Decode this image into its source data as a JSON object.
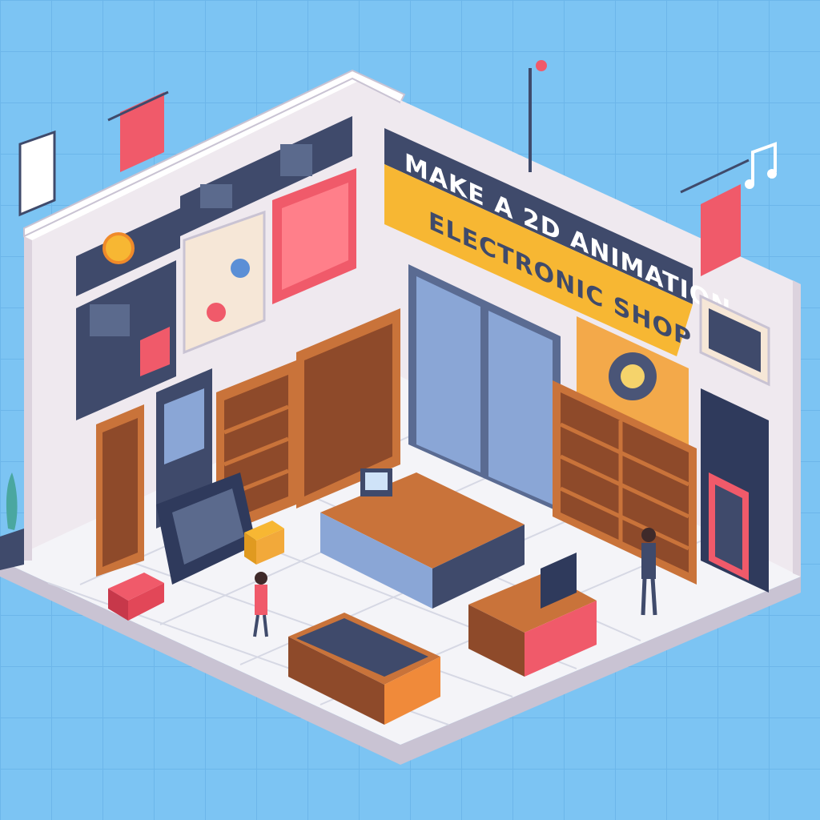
{
  "scene": {
    "description_free": true,
    "colors": {
      "background": "#7cc4f3",
      "grid": "#6cb6ea",
      "wall": "#efe9ef",
      "wall_shade": "#dcd3de",
      "floor": "#f4f4f8",
      "floor_line": "#d6d8e4",
      "sign_dark": "#3f4a6b",
      "sign_yellow": "#f7b733",
      "accent_red": "#f05a6a",
      "wood": "#c9733a",
      "wood_dark": "#8e4a2a",
      "navy": "#2f3a5c"
    },
    "sign": {
      "line1": "MAKE A 2D ANIMATION",
      "line2": "ELECTRONIC SHOP"
    }
  }
}
